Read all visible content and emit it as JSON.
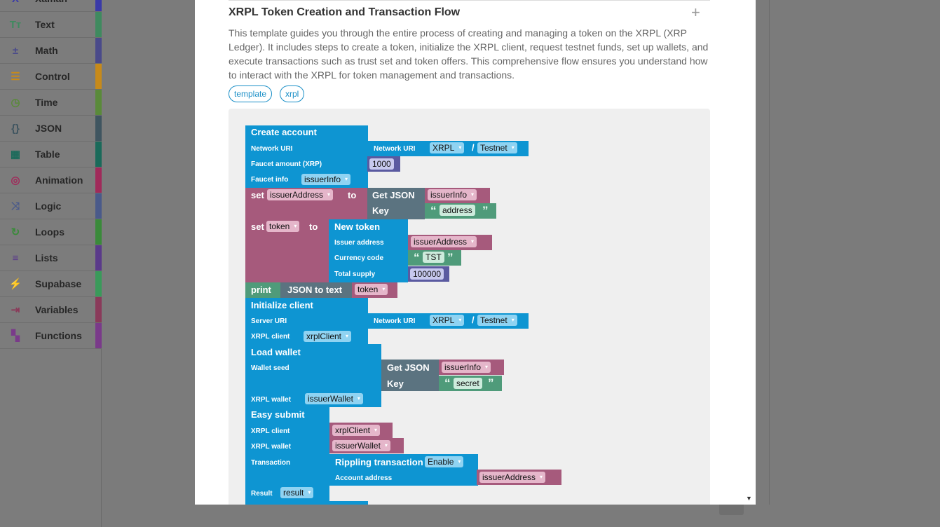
{
  "sidebar": {
    "items": [
      {
        "label": "Xaman",
        "icon": "xaman-icon",
        "color": "#3a3aa8"
      },
      {
        "label": "Text",
        "icon": "text-icon",
        "color": "#3f8a5f"
      },
      {
        "label": "Math",
        "icon": "math-icon",
        "color": "#4a4a8a"
      },
      {
        "label": "Control",
        "icon": "control-icon",
        "color": "#c78a1a"
      },
      {
        "label": "Time",
        "icon": "clock-icon",
        "color": "#5a8a3a"
      },
      {
        "label": "JSON",
        "icon": "json-braces-icon",
        "color": "#3f5560"
      },
      {
        "label": "Table",
        "icon": "table-icon",
        "color": "#1a6a5a"
      },
      {
        "label": "Animation",
        "icon": "animation-icon",
        "color": "#a02a5a"
      },
      {
        "label": "Logic",
        "icon": "logic-shuffle-icon",
        "color": "#4a5a8a"
      },
      {
        "label": "Loops",
        "icon": "loop-icon",
        "color": "#3a8a3a"
      },
      {
        "label": "Lists",
        "icon": "list-icon",
        "color": "#5a3a8a"
      },
      {
        "label": "Supabase",
        "icon": "supabase-bolt-icon",
        "color": "#3a9a5a"
      },
      {
        "label": "Variables",
        "icon": "variables-icon",
        "color": "#8a3a5a"
      },
      {
        "label": "Functions",
        "icon": "functions-icon",
        "color": "#7a3a8a"
      }
    ]
  },
  "modal": {
    "title": "XRPL Token Creation and Transaction Flow",
    "description": "This template guides you through the entire process of creating and managing a token on the XRPL (XRP Ledger). It includes steps to create a token, initialize the XRPL client, request testnet funds, set up wallets, and execute transactions such as trust set and token offers. This comprehensive flow ensures you understand how to interact with the XRPL for token management and transactions.",
    "tags": [
      "template",
      "xrpl"
    ],
    "plus_icon": "+",
    "scroll_arrow": "▼"
  },
  "blocks": {
    "create_account": "Create account",
    "network_uri": "Network URI",
    "faucet_amount": "Faucet amount (XRP)",
    "faucet_info": "Faucet info",
    "network_uri_inner": "Network URI",
    "xrpl": "XRPL",
    "slash": "/",
    "testnet": "Testnet",
    "amount_1000": "1000",
    "issuer_info_var": "issuerInfo",
    "set": "set",
    "to": "to",
    "issuer_address_var": "issuerAddress",
    "get_json": "Get JSON",
    "key": "Key",
    "address_str": "address",
    "token_var": "token",
    "new_token": "New token",
    "issuer_address_lbl": "Issuer address",
    "currency_code": "Currency code",
    "total_supply": "Total supply",
    "tst_str": "TST",
    "supply_100000": "100000",
    "print": "print",
    "json_to_text": "JSON to text",
    "initialize_client": "Initialize client",
    "server_uri": "Server URI",
    "xrpl_client_lbl": "XRPL client",
    "xrpl_client_var": "xrplClient",
    "load_wallet": "Load wallet",
    "wallet_seed": "Wallet seed",
    "secret_str": "secret",
    "xrpl_wallet_lbl": "XRPL wallet",
    "issuer_wallet_var": "issuerWallet",
    "easy_submit": "Easy submit",
    "transaction_lbl": "Transaction",
    "rippling_transaction": "Rippling transaction",
    "enable": "Enable",
    "account_address": "Account address",
    "result_lbl": "Result",
    "result_var": "result",
    "open_quote": "“",
    "close_quote": "”",
    "caret": "▾"
  }
}
